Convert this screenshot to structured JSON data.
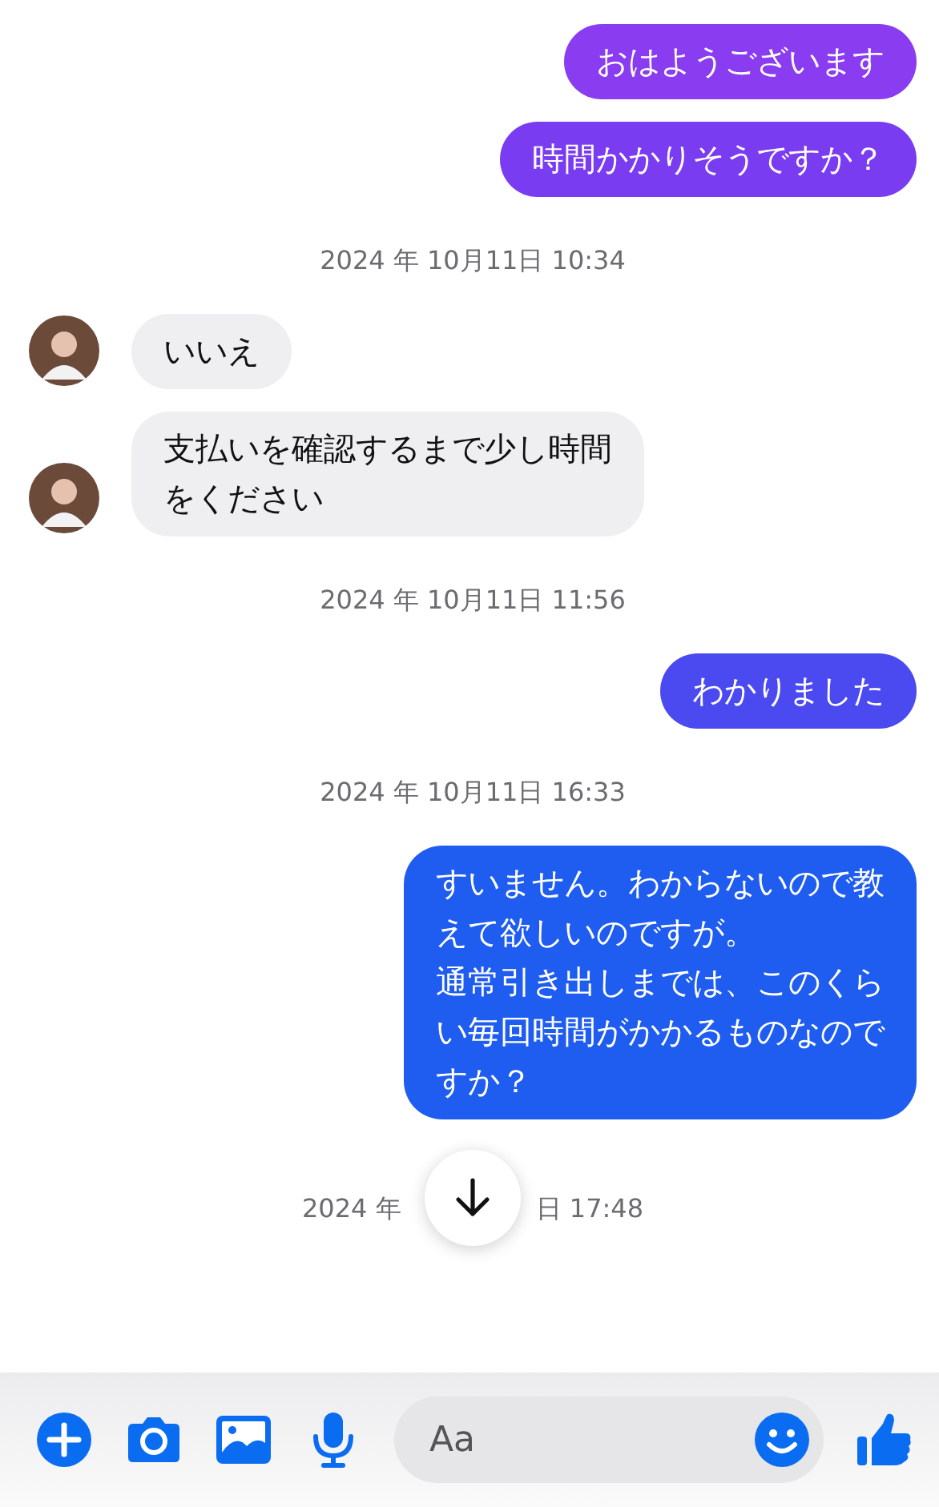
{
  "messages": [
    {
      "kind": "outgoing",
      "lines": [
        "おはようございます"
      ],
      "color": "#8a3cf0"
    },
    {
      "kind": "outgoing",
      "lines": [
        "時間かかりそうですか？"
      ],
      "color": "#7a3cf0"
    },
    {
      "kind": "timestamp",
      "text": "2024 年 10月11日 10:34"
    },
    {
      "kind": "incoming",
      "lines": [
        "いいえ"
      ]
    },
    {
      "kind": "incoming",
      "lines": [
        "支払いを確認するまで少し時間",
        "をください"
      ]
    },
    {
      "kind": "timestamp",
      "text": "2024 年 10月11日 11:56"
    },
    {
      "kind": "outgoing",
      "lines": [
        "わかりました"
      ],
      "color": "#4a4af0"
    },
    {
      "kind": "timestamp",
      "text": "2024 年 10月11日 16:33"
    },
    {
      "kind": "outgoing",
      "lines": [
        "すいません。わからないので教",
        "えて欲しいのですが。",
        "通常引き出しまでは、このくら",
        "い毎回時間がかかるものなので",
        "すか？"
      ],
      "color": "#1f5cf0"
    }
  ],
  "last_timestamp": {
    "before": "2024 年",
    "after": "日 17:48"
  },
  "composer": {
    "placeholder": "Aa"
  }
}
